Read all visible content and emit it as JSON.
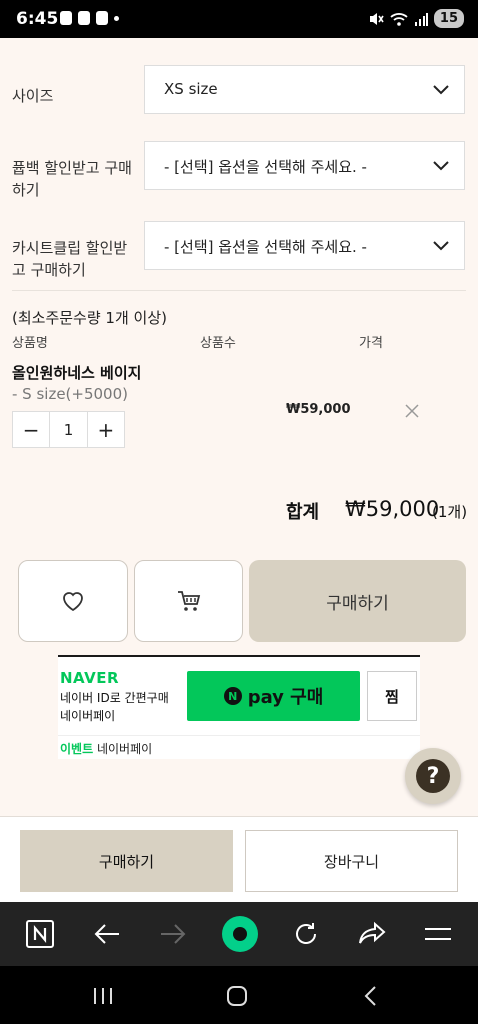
{
  "status_bar": {
    "time": "6:45",
    "battery": "15"
  },
  "options": [
    {
      "label": "사이즈",
      "value": "XS size"
    },
    {
      "label": "퓹백 할인받고 구매하기",
      "value": "- [선택] 옵션을 선택해 주세요. -"
    },
    {
      "label": "카시트클립 할인받고 구매하기",
      "value": "- [선택] 옵션을 선택해 주세요. -"
    }
  ],
  "order": {
    "min_notice": "(최소주문수량 1개 이상)",
    "columns": [
      "상품명",
      "상품수",
      "가격"
    ],
    "item": {
      "name": "올인원하네스 베이지",
      "option": "- S size(+5000)",
      "quantity": "1",
      "price": "₩59,000"
    },
    "qty_minus": "−",
    "qty_plus": "+"
  },
  "total": {
    "label": "합계",
    "price": "₩59,000",
    "count": "(1개)"
  },
  "actions": {
    "wishlist_icon": "heart-icon",
    "cart_icon": "cart-icon",
    "buy_label": "구매하기"
  },
  "naver_pay": {
    "logo": "NAVER",
    "line1": "네이버 ID로 간편구매",
    "line2": "네이버페이",
    "pay_n": "N",
    "pay_label": "pay 구매",
    "jjim_label": "찜",
    "event_tag": "이벤트",
    "event_text": "네이버페이"
  },
  "help_button": "?",
  "bottom_bar": {
    "buy_label": "구매하기",
    "cart_label": "장바구니"
  },
  "colors": {
    "background": "#fdf6f1",
    "accent": "#d8d1c2",
    "naver_green": "#03c75a"
  }
}
